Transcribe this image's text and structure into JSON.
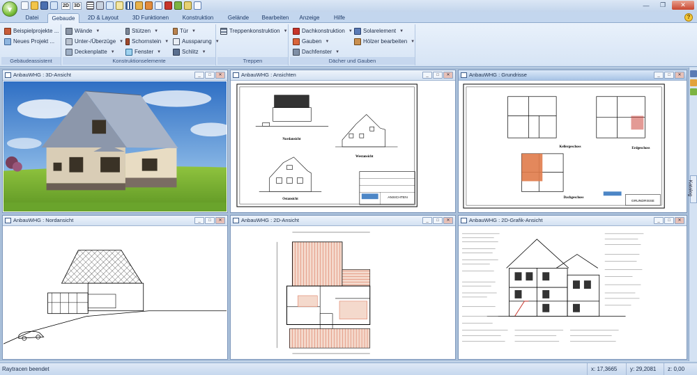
{
  "menu_tabs": [
    "Datei",
    "Gebaude",
    "2D & Layout",
    "3D Funktionen",
    "Konstruktion",
    "Gelände",
    "Bearbeiten",
    "Anzeige",
    "Hilfe"
  ],
  "active_tab": "Gebaude",
  "qat_labels": {
    "a": "2D",
    "b": "3D"
  },
  "ribbon": {
    "gebaeudeassistent": {
      "title": "Gebäudeassistent",
      "items": [
        "Beispielprojekte ...",
        "Neues Projekt ..."
      ]
    },
    "konstruktionselemente": {
      "title": "Konstruktionselemente",
      "col1": [
        "Wände",
        "Unter-/Überzüge",
        "Deckenplatte"
      ],
      "col2": [
        "Stützen",
        "Schornstein",
        "Fenster"
      ],
      "col3": [
        "Tür",
        "Aussparung",
        "Schlitz"
      ]
    },
    "treppen": {
      "title": "Treppen",
      "items": [
        "Treppenkonstruktion"
      ]
    },
    "daecher": {
      "title": "Dächer und Gauben",
      "col1": [
        "Dachkonstruktion",
        "Gauben",
        "Dachfenster"
      ],
      "col2": [
        "Solarelement",
        "Hölzer bearbeiten"
      ]
    }
  },
  "windows": {
    "w3d": {
      "title": "AnbauWHG : 3D-Ansicht"
    },
    "ansichten": {
      "title": "AnbauWHG : Ansichten",
      "labels": {
        "nord": "Nordansicht",
        "west": "Westansicht",
        "ost": "Ostansicht",
        "stamp": "ANSICHTEN"
      }
    },
    "grundrisse": {
      "title": "AnbauWHG : Grundrisse",
      "labels": {
        "keller": "Kellergeschoss",
        "erd": "Erdgeschoss",
        "dach": "Dachgeschoss",
        "stamp": "GRUNDRISSE"
      }
    },
    "nordansicht": {
      "title": "AnbauWHG : Nordansicht"
    },
    "w2d": {
      "title": "AnbauWHG : 2D-Ansicht"
    },
    "grafik": {
      "title": "AnbauWHG : 2D-Grafik-Ansicht"
    }
  },
  "side": {
    "catalog": "Katalog"
  },
  "status": {
    "message": "Raytracen beendet",
    "x": "x: 17,3665",
    "y": "y: 29,2081",
    "z": "z: 0,00"
  },
  "colors": {
    "accent": "#7bbf3a",
    "ribbon": "#dbe7f5",
    "close": "#c8462f"
  },
  "icons": [
    "app-orb-icon",
    "help-icon",
    "house-icon",
    "wall-icon",
    "roof-icon",
    "window-icon",
    "door-icon",
    "stairs-icon",
    "solar-icon",
    "catalog-icon"
  ]
}
